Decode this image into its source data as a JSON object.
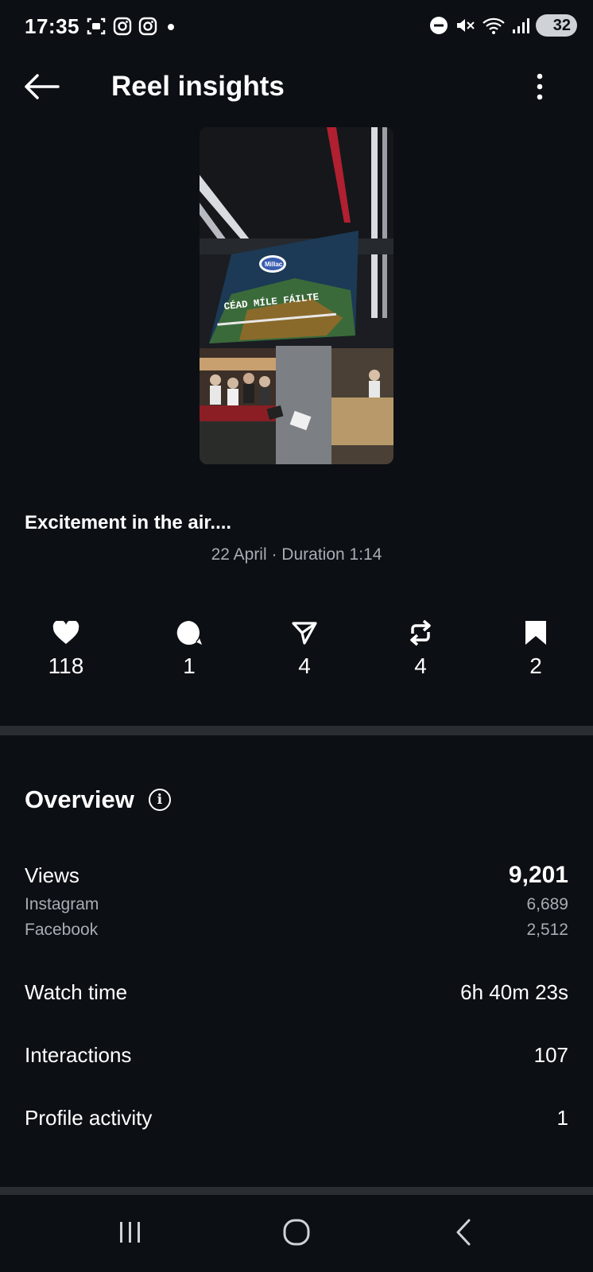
{
  "status_bar": {
    "time": "17:35",
    "battery": "32",
    "left_icons": [
      "screenshot-icon",
      "instagram-icon",
      "instagram-icon",
      "dot-icon"
    ],
    "right_icons": [
      "dnd-icon",
      "mute-icon",
      "wifi-icon",
      "signal-icon",
      "battery-icon"
    ]
  },
  "header": {
    "title": "Reel insights",
    "back_icon": "arrow-left-icon",
    "more_icon": "more-vertical-icon"
  },
  "reel": {
    "thumbnail_text": "CÉAD MÍLE FÁILTE",
    "thumbnail_logo": "Millac",
    "caption": "Excitement in the air....",
    "meta": "22 April · Duration 1:14"
  },
  "stats": [
    {
      "icon": "heart-icon",
      "value": "118"
    },
    {
      "icon": "comment-icon",
      "value": "1"
    },
    {
      "icon": "share-icon",
      "value": "4"
    },
    {
      "icon": "repost-icon",
      "value": "4"
    },
    {
      "icon": "bookmark-icon",
      "value": "2"
    }
  ],
  "overview": {
    "title": "Overview",
    "views": {
      "label": "Views",
      "value": "9,201"
    },
    "instagram": {
      "label": "Instagram",
      "value": "6,689"
    },
    "facebook": {
      "label": "Facebook",
      "value": "2,512"
    },
    "watch_time": {
      "label": "Watch time",
      "value": "6h 40m 23s"
    },
    "interactions": {
      "label": "Interactions",
      "value": "107"
    },
    "profile_activity": {
      "label": "Profile activity",
      "value": "1"
    }
  },
  "colors": {
    "background": "#0c0f14",
    "divider": "#2a2e33",
    "secondary_text": "#a8adb4"
  }
}
